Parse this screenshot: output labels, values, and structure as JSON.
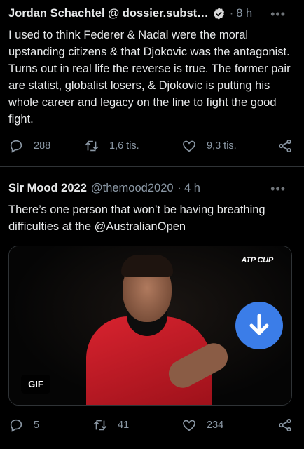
{
  "tweets": [
    {
      "author_name": "Jordan Schachtel @ dossier.subst…",
      "verified": true,
      "time": "8 h",
      "more": "•••",
      "text": "I used to think Federer & Nadal were the moral upstanding citizens & that Djokovic was the antagonist. Turns out in real life the reverse is true. The former pair are statist, globalist losers, & Djokovic is putting his whole career and legacy on the line to fight the good fight.",
      "actions": {
        "replies": "288",
        "retweets": "1,6 tis.",
        "likes": "9,3 tis."
      }
    },
    {
      "author_name": "Sir Mood 2022",
      "handle": "@themood2020",
      "time": "4 h",
      "more": "•••",
      "text_before": "There’s one person that won’t be having breathing difficulties at the ",
      "mention": "@AustralianOpen",
      "media": {
        "brand": "ATP CUP",
        "gif_badge": "GIF",
        "download_icon": "arrow-down-icon",
        "accent": "#3b7de8"
      },
      "actions": {
        "replies": "5",
        "retweets": "41",
        "likes": "234"
      }
    }
  ],
  "colors": {
    "background": "#000000",
    "text": "#e7e9ea",
    "muted": "#8b98a5",
    "divider": "#2f3336"
  }
}
